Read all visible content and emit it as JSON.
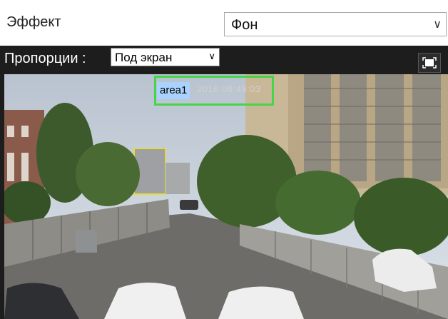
{
  "settings": {
    "effect_label": "Эффект",
    "effect_value": "Фон"
  },
  "viewer": {
    "proportions_label": "Пропорции :",
    "proportions_value": "Под экран",
    "fullscreen_icon": "fullscreen-icon",
    "area_label": "area1",
    "timestamp": "2016 08:49:03"
  },
  "colors": {
    "area_border": "#46d548",
    "area_tag_bg": "#a9d2ff",
    "toolbar_bg": "#1d1d1d"
  }
}
